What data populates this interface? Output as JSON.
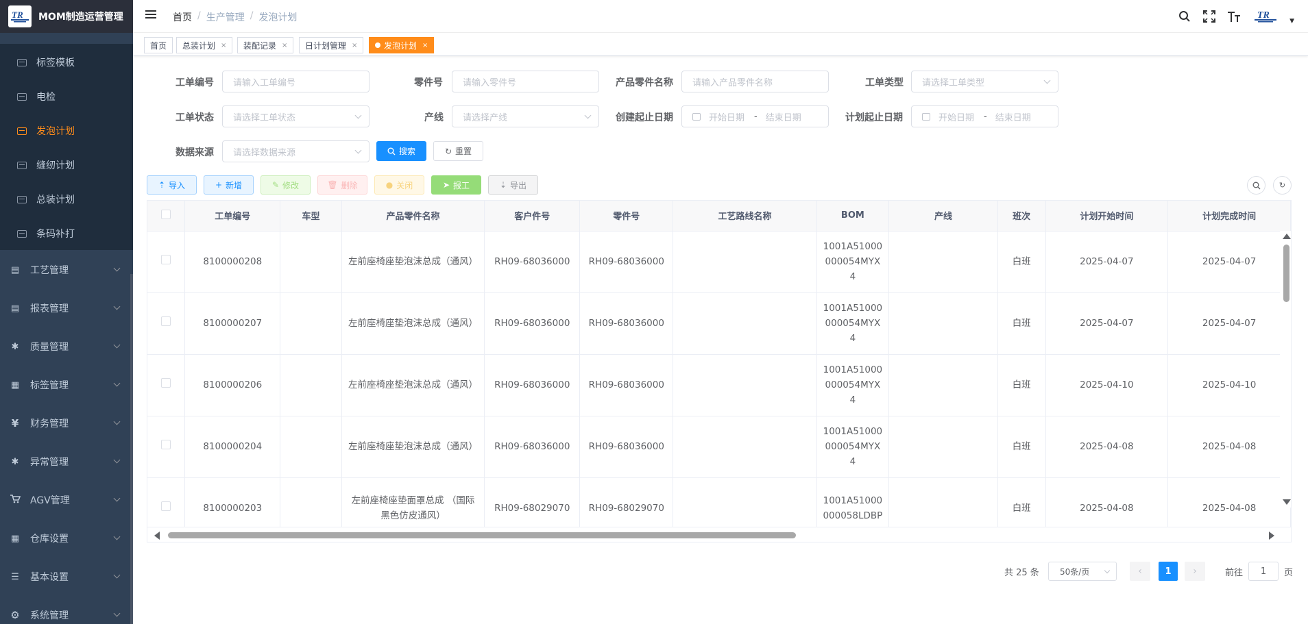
{
  "app": {
    "title": "MOM制造运营管理",
    "logo_text": "TR"
  },
  "sidebar": {
    "sub_items": [
      {
        "label": "标签模板",
        "active": false
      },
      {
        "label": "电检",
        "active": false
      },
      {
        "label": "发泡计划",
        "active": true
      },
      {
        "label": "缝纫计划",
        "active": false
      },
      {
        "label": "总装计划",
        "active": false
      },
      {
        "label": "条码补打",
        "active": false
      }
    ],
    "items": [
      {
        "label": "工艺管理",
        "icon": "monitor-icon"
      },
      {
        "label": "报表管理",
        "icon": "chart-icon"
      },
      {
        "label": "质量管理",
        "icon": "bug-icon"
      },
      {
        "label": "标签管理",
        "icon": "table-icon"
      },
      {
        "label": "财务管理",
        "icon": "yen-icon"
      },
      {
        "label": "异常管理",
        "icon": "bug-icon"
      },
      {
        "label": "AGV管理",
        "icon": "cart-icon"
      },
      {
        "label": "仓库设置",
        "icon": "table-icon"
      },
      {
        "label": "基本设置",
        "icon": "sliders-icon"
      },
      {
        "label": "系统管理",
        "icon": "gear-icon"
      }
    ]
  },
  "breadcrumb": [
    "首页",
    "生产管理",
    "发泡计划"
  ],
  "tags": [
    {
      "label": "首页",
      "active": false,
      "closable": false
    },
    {
      "label": "总装计划",
      "active": false,
      "closable": true
    },
    {
      "label": "装配记录",
      "active": false,
      "closable": true
    },
    {
      "label": "日计划管理",
      "active": false,
      "closable": true
    },
    {
      "label": "发泡计划",
      "active": true,
      "closable": true
    }
  ],
  "filters": {
    "order_no": {
      "label": "工单编号",
      "placeholder": "请输入工单编号"
    },
    "part_no": {
      "label": "零件号",
      "placeholder": "请输入零件号"
    },
    "product_name": {
      "label": "产品零件名称",
      "placeholder": "请输入产品零件名称"
    },
    "order_type": {
      "label": "工单类型",
      "placeholder": "请选择工单类型"
    },
    "order_status": {
      "label": "工单状态",
      "placeholder": "请选择工单状态"
    },
    "line": {
      "label": "产线",
      "placeholder": "请选择产线"
    },
    "create_date": {
      "label": "创建起止日期",
      "start": "开始日期",
      "sep": "-",
      "end": "结束日期"
    },
    "plan_date": {
      "label": "计划起止日期",
      "start": "开始日期",
      "sep": "-",
      "end": "结束日期"
    },
    "source": {
      "label": "数据来源",
      "placeholder": "请选择数据来源"
    },
    "search_label": "搜索",
    "reset_label": "重置"
  },
  "toolbar": {
    "import": "导入",
    "add": "新增",
    "edit": "修改",
    "delete": "删除",
    "close": "关闭",
    "report": "报工",
    "export": "导出"
  },
  "table": {
    "columns": [
      "工单编号",
      "车型",
      "产品零件名称",
      "客户件号",
      "零件号",
      "工艺路线名称",
      "BOM",
      "产线",
      "班次",
      "计划开始时间",
      "计划完成时间"
    ],
    "rows": [
      {
        "order_no": "8100000208",
        "model": "",
        "product": "左前座椅座垫泡沫总成（通风）",
        "cust_no": "RH09-68036000",
        "part_no": "RH09-68036000",
        "route": "",
        "bom": "1001A51000000054MYX4",
        "line": "",
        "shift": "白班",
        "start": "2025-04-07",
        "end": "2025-04-07"
      },
      {
        "order_no": "8100000207",
        "model": "",
        "product": "左前座椅座垫泡沫总成（通风）",
        "cust_no": "RH09-68036000",
        "part_no": "RH09-68036000",
        "route": "",
        "bom": "1001A51000000054MYX4",
        "line": "",
        "shift": "白班",
        "start": "2025-04-07",
        "end": "2025-04-07"
      },
      {
        "order_no": "8100000206",
        "model": "",
        "product": "左前座椅座垫泡沫总成（通风）",
        "cust_no": "RH09-68036000",
        "part_no": "RH09-68036000",
        "route": "",
        "bom": "1001A51000000054MYX4",
        "line": "",
        "shift": "白班",
        "start": "2025-04-10",
        "end": "2025-04-10"
      },
      {
        "order_no": "8100000204",
        "model": "",
        "product": "左前座椅座垫泡沫总成（通风）",
        "cust_no": "RH09-68036000",
        "part_no": "RH09-68036000",
        "route": "",
        "bom": "1001A51000000054MYX4",
        "line": "",
        "shift": "白班",
        "start": "2025-04-08",
        "end": "2025-04-08"
      },
      {
        "order_no": "8100000203",
        "model": "",
        "product": "左前座椅座垫面罩总成 （国际黑色仿皮通风）",
        "cust_no": "RH09-68029070",
        "part_no": "RH09-68029070",
        "route": "",
        "bom": "1001A51000000058LDBP",
        "line": "",
        "shift": "白班",
        "start": "2025-04-08",
        "end": "2025-04-08"
      }
    ]
  },
  "pagination": {
    "total_text": "共 25 条",
    "page_size": "50条/页",
    "current_page": "1",
    "goto_prefix": "前往",
    "goto_value": "1",
    "goto_suffix": "页"
  },
  "colors": {
    "accent": "#ff8c1a",
    "primary": "#1890ff",
    "sidebar_bg": "#304156"
  }
}
